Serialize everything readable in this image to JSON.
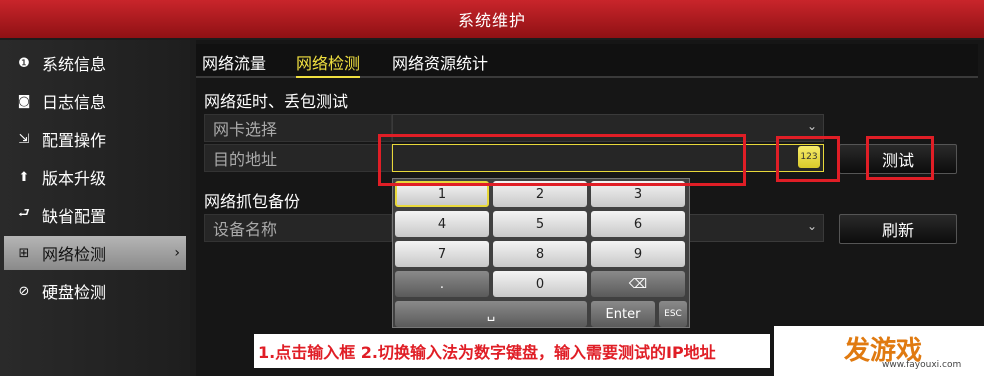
{
  "window": {
    "title": "系统维护"
  },
  "sidebar": {
    "items": [
      {
        "label": "系统信息",
        "icon": "info-icon"
      },
      {
        "label": "日志信息",
        "icon": "log-search-icon"
      },
      {
        "label": "配置操作",
        "icon": "config-icon"
      },
      {
        "label": "版本升级",
        "icon": "upgrade-icon"
      },
      {
        "label": "缺省配置",
        "icon": "default-icon"
      },
      {
        "label": "网络检测",
        "icon": "network-icon",
        "active": true
      },
      {
        "label": "硬盘检测",
        "icon": "disk-icon"
      }
    ]
  },
  "tabs": [
    {
      "label": "网络流量"
    },
    {
      "label": "网络检测",
      "active": true
    },
    {
      "label": "网络资源统计"
    }
  ],
  "latency": {
    "title": "网络延时、丢包测试",
    "nic_label": "网卡选择",
    "dest_label": "目的地址",
    "dest_value": "",
    "kb_switch_label": "123",
    "test_button": "测试"
  },
  "capture": {
    "title": "网络抓包备份",
    "device_label": "设备名称",
    "refresh_button": "刷新"
  },
  "keypad": {
    "rows": [
      [
        "1",
        "2",
        "3"
      ],
      [
        "4",
        "5",
        "6"
      ],
      [
        "7",
        "8",
        "9"
      ],
      [
        ".",
        "0",
        "⌫"
      ]
    ],
    "space": "␣",
    "enter": "Enter",
    "esc": "ESC"
  },
  "annotation": "1.点击输入框   2.切换输入法为数字键盘，输入需要测试的IP地址",
  "watermark": {
    "brand": "发游戏",
    "url": "www.fayouxi.com"
  },
  "colors": {
    "title_red": "#c9252b",
    "highlight_yellow": "#e8d83a",
    "annotation_red": "#e01e26"
  }
}
